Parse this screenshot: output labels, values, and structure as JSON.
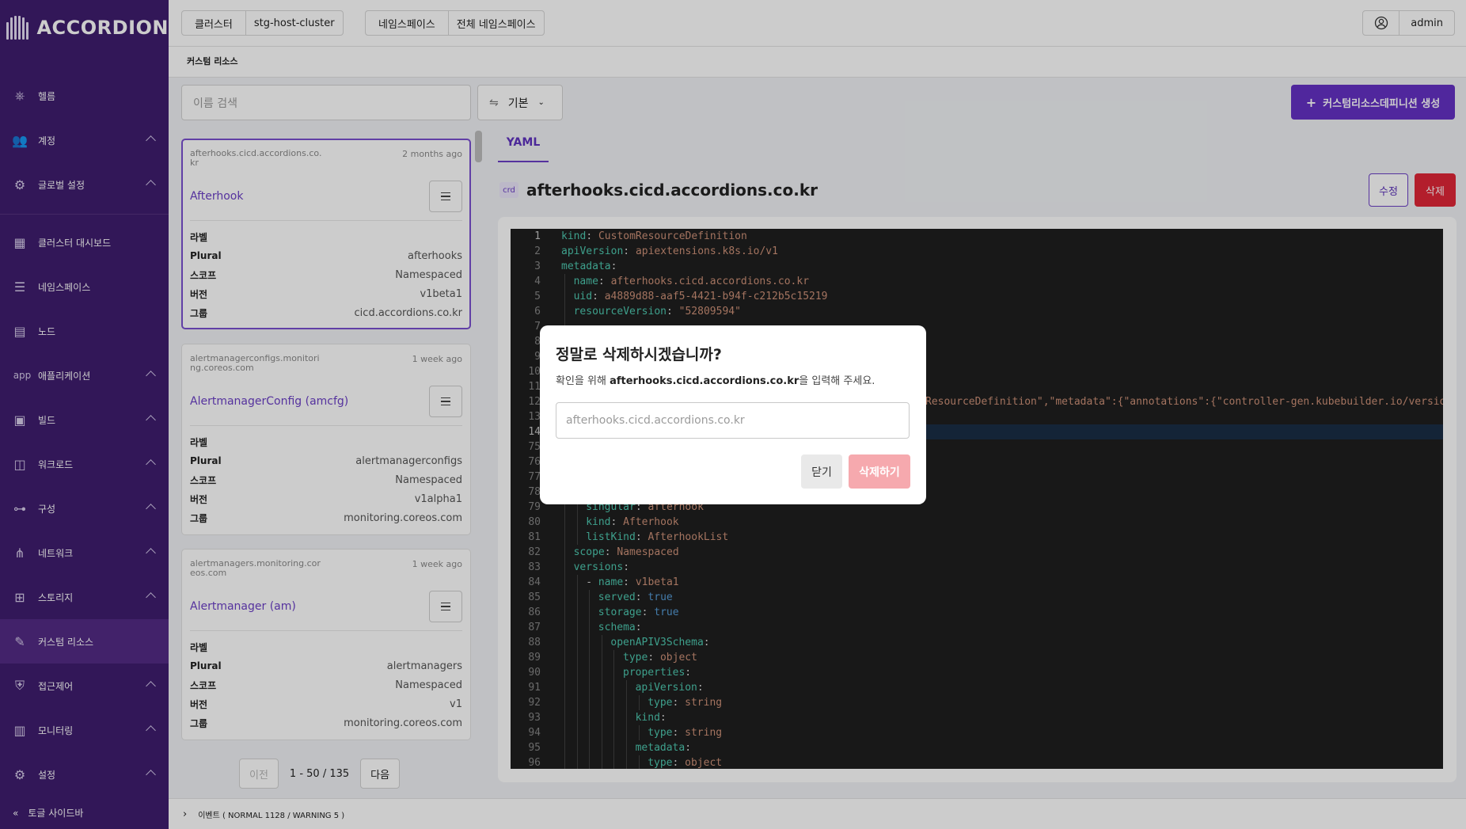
{
  "app": {
    "logo_text": "ACCORDION"
  },
  "sidebar": {
    "items": [
      {
        "label": "헬름",
        "icon": "helm-icon"
      },
      {
        "label": "계정",
        "icon": "users-icon",
        "expandable": true
      },
      {
        "label": "글로벌 설정",
        "icon": "gear-icon",
        "expandable": true
      },
      {
        "label": "클러스터 대시보드",
        "icon": "dashboard-icon"
      },
      {
        "label": "네임스페이스",
        "icon": "namespace-icon"
      },
      {
        "label": "노드",
        "icon": "server-icon"
      },
      {
        "label": "애플리케이션",
        "icon": "app-icon",
        "icon_text": "app",
        "expandable": true
      },
      {
        "label": "빌드",
        "icon": "build-icon",
        "expandable": true
      },
      {
        "label": "워크로드",
        "icon": "workload-icon",
        "expandable": true
      },
      {
        "label": "구성",
        "icon": "sliders-icon",
        "expandable": true
      },
      {
        "label": "네트워크",
        "icon": "network-icon",
        "expandable": true
      },
      {
        "label": "스토리지",
        "icon": "storage-icon",
        "expandable": true
      },
      {
        "label": "커스텀 리소스",
        "icon": "custom-resource-icon",
        "active": true
      },
      {
        "label": "접근제어",
        "icon": "shield-icon",
        "expandable": true
      },
      {
        "label": "모니터링",
        "icon": "chart-icon",
        "expandable": true
      },
      {
        "label": "설정",
        "icon": "gear-icon",
        "expandable": true
      }
    ],
    "toggle_label": "토글 사이드바"
  },
  "topbar": {
    "cluster_label": "클러스터",
    "cluster_value": "stg-host-cluster",
    "namespace_label": "네임스페이스",
    "namespace_value": "전체 네임스페이스",
    "user": "admin"
  },
  "breadcrumb": "커스텀 리소스",
  "toolbar": {
    "search_placeholder": "이름 검색",
    "filter_value": "기본",
    "create_label": "커스텀리소스데피니션 생성"
  },
  "cards": [
    {
      "source": "afterhooks.cicd.accordions.co.kr",
      "age": "2 months ago",
      "title": "Afterhook",
      "label_key": "라벨",
      "rows": [
        {
          "k": "Plural",
          "v": "afterhooks"
        },
        {
          "k": "스코프",
          "v": "Namespaced"
        },
        {
          "k": "버전",
          "v": "v1beta1"
        },
        {
          "k": "그룹",
          "v": "cicd.accordions.co.kr"
        }
      ]
    },
    {
      "source": "alertmanagerconfigs.monitoring.coreos.com",
      "age": "1 week ago",
      "title": "AlertmanagerConfig (amcfg)",
      "label_key": "라벨",
      "rows": [
        {
          "k": "Plural",
          "v": "alertmanagerconfigs"
        },
        {
          "k": "스코프",
          "v": "Namespaced"
        },
        {
          "k": "버전",
          "v": "v1alpha1"
        },
        {
          "k": "그룹",
          "v": "monitoring.coreos.com"
        }
      ]
    },
    {
      "source": "alertmanagers.monitoring.coreos.com",
      "age": "1 week ago",
      "title": "Alertmanager (am)",
      "label_key": "라벨",
      "rows": [
        {
          "k": "Plural",
          "v": "alertmanagers"
        },
        {
          "k": "스코프",
          "v": "Namespaced"
        },
        {
          "k": "버전",
          "v": "v1"
        },
        {
          "k": "그룹",
          "v": "monitoring.coreos.com"
        }
      ]
    }
  ],
  "pager": {
    "prev": "이전",
    "range": "1 - 50 / 135",
    "next": "다음"
  },
  "detail": {
    "tab": "YAML",
    "tag": "crd",
    "title": "afterhooks.cicd.accordions.co.kr",
    "edit_label": "수정",
    "delete_label": "삭제"
  },
  "yaml_lines": [
    {
      "n": "1",
      "indent": 0,
      "parts": [
        [
          "k",
          "kind"
        ],
        [
          "p",
          ": "
        ],
        [
          "s",
          "CustomResourceDefinition"
        ]
      ]
    },
    {
      "n": "2",
      "indent": 0,
      "parts": [
        [
          "k",
          "apiVersion"
        ],
        [
          "p",
          ": "
        ],
        [
          "s",
          "apiextensions.k8s.io/v1"
        ]
      ]
    },
    {
      "n": "3",
      "indent": 0,
      "parts": [
        [
          "k",
          "metadata"
        ],
        [
          "p",
          ":"
        ]
      ]
    },
    {
      "n": "4",
      "indent": 1,
      "parts": [
        [
          "k",
          "name"
        ],
        [
          "p",
          ": "
        ],
        [
          "s",
          "afterhooks.cicd.accordions.co.kr"
        ]
      ]
    },
    {
      "n": "5",
      "indent": 1,
      "parts": [
        [
          "k",
          "uid"
        ],
        [
          "p",
          ": "
        ],
        [
          "s",
          "a4889d88-aaf5-4421-b94f-c212b5c15219"
        ]
      ]
    },
    {
      "n": "6",
      "indent": 1,
      "parts": [
        [
          "k",
          "resourceVersion"
        ],
        [
          "p",
          ": "
        ],
        [
          "s",
          "\"52809594\""
        ]
      ]
    },
    {
      "n": "7",
      "indent": 1,
      "parts": []
    },
    {
      "n": "8",
      "indent": 1,
      "parts": []
    },
    {
      "n": "9",
      "indent": 1,
      "parts": []
    },
    {
      "n": "10",
      "indent": 1,
      "parts": []
    },
    {
      "n": "11",
      "indent": 1,
      "parts": []
    },
    {
      "n": "12",
      "indent": 1,
      "parts": []
    },
    {
      "n": "13",
      "indent": 1,
      "parts": []
    },
    {
      "n": "14",
      "indent": 1,
      "parts": []
    },
    {
      "n": "75",
      "indent": 1,
      "parts": []
    },
    {
      "n": "76",
      "indent": 1,
      "parts": []
    },
    {
      "n": "77",
      "indent": 1,
      "parts": []
    },
    {
      "n": "78",
      "indent": 1,
      "parts": []
    },
    {
      "n": "79",
      "indent": 2,
      "parts": [
        [
          "k",
          "singular"
        ],
        [
          "p",
          ": "
        ],
        [
          "s",
          "afterhook"
        ]
      ]
    },
    {
      "n": "80",
      "indent": 2,
      "parts": [
        [
          "k",
          "kind"
        ],
        [
          "p",
          ": "
        ],
        [
          "s",
          "Afterhook"
        ]
      ]
    },
    {
      "n": "81",
      "indent": 2,
      "parts": [
        [
          "k",
          "listKind"
        ],
        [
          "p",
          ": "
        ],
        [
          "s",
          "AfterhookList"
        ]
      ]
    },
    {
      "n": "82",
      "indent": 1,
      "parts": [
        [
          "k",
          "scope"
        ],
        [
          "p",
          ": "
        ],
        [
          "s",
          "Namespaced"
        ]
      ]
    },
    {
      "n": "83",
      "indent": 1,
      "parts": [
        [
          "k",
          "versions"
        ],
        [
          "p",
          ":"
        ]
      ]
    },
    {
      "n": "84",
      "indent": 2,
      "parts": [
        [
          "p",
          "- "
        ],
        [
          "k",
          "name"
        ],
        [
          "p",
          ": "
        ],
        [
          "s",
          "v1beta1"
        ]
      ]
    },
    {
      "n": "85",
      "indent": 3,
      "parts": [
        [
          "k",
          "served"
        ],
        [
          "p",
          ": "
        ],
        [
          "b",
          "true"
        ]
      ]
    },
    {
      "n": "86",
      "indent": 3,
      "parts": [
        [
          "k",
          "storage"
        ],
        [
          "p",
          ": "
        ],
        [
          "b",
          "true"
        ]
      ]
    },
    {
      "n": "87",
      "indent": 3,
      "parts": [
        [
          "k",
          "schema"
        ],
        [
          "p",
          ":"
        ]
      ]
    },
    {
      "n": "88",
      "indent": 4,
      "parts": [
        [
          "k",
          "openAPIV3Schema"
        ],
        [
          "p",
          ":"
        ]
      ]
    },
    {
      "n": "89",
      "indent": 5,
      "parts": [
        [
          "k",
          "type"
        ],
        [
          "p",
          ": "
        ],
        [
          "s",
          "object"
        ]
      ]
    },
    {
      "n": "90",
      "indent": 5,
      "parts": [
        [
          "k",
          "properties"
        ],
        [
          "p",
          ":"
        ]
      ]
    },
    {
      "n": "91",
      "indent": 6,
      "parts": [
        [
          "k",
          "apiVersion"
        ],
        [
          "p",
          ":"
        ]
      ]
    },
    {
      "n": "92",
      "indent": 7,
      "parts": [
        [
          "k",
          "type"
        ],
        [
          "p",
          ": "
        ],
        [
          "s",
          "string"
        ]
      ]
    },
    {
      "n": "93",
      "indent": 6,
      "parts": [
        [
          "k",
          "kind"
        ],
        [
          "p",
          ":"
        ]
      ]
    },
    {
      "n": "94",
      "indent": 7,
      "parts": [
        [
          "k",
          "type"
        ],
        [
          "p",
          ": "
        ],
        [
          "s",
          "string"
        ]
      ]
    },
    {
      "n": "95",
      "indent": 6,
      "parts": [
        [
          "k",
          "metadata"
        ],
        [
          "p",
          ":"
        ]
      ]
    },
    {
      "n": "96",
      "indent": 7,
      "parts": [
        [
          "k",
          "type"
        ],
        [
          "p",
          ": "
        ],
        [
          "s",
          "object"
        ]
      ]
    }
  ],
  "yaml_line12_tail": "ResourceDefinition\",\"metadata\":{\"annotations\":{\"controller-gen.kubebuilder.io/version",
  "events": "이벤트 ( NORMAL 1128 / WARNING 5 )",
  "modal": {
    "title": "정말로 삭제하시겠습니까?",
    "desc_prefix": "확인을 위해 ",
    "desc_target": "afterhooks.cicd.accordions.co.kr",
    "desc_suffix": "을 입력해 주세요.",
    "input_placeholder": "afterhooks.cicd.accordions.co.kr",
    "close_label": "닫기",
    "confirm_label": "삭제하기"
  },
  "colors": {
    "sidebar": "#3f1d6e",
    "accent": "#6431c5",
    "danger": "#e02638"
  }
}
